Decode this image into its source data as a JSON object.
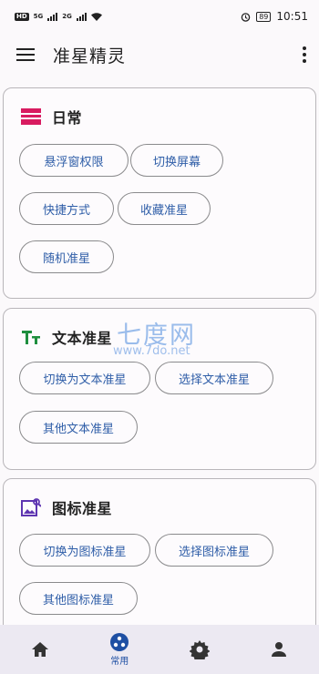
{
  "status_bar": {
    "left_badges": [
      "HD",
      "5G",
      "2G"
    ],
    "battery": "89",
    "time": "10:51"
  },
  "app_bar": {
    "title": "准星精灵"
  },
  "sections": [
    {
      "title": "日常",
      "icon": "calendar-icon",
      "icon_color": "#d81b60",
      "buttons": [
        "悬浮窗权限",
        "切换屏幕",
        "快捷方式",
        "收藏准星",
        "随机准星"
      ]
    },
    {
      "title": "文本准星",
      "icon": "text-format-icon",
      "icon_color": "#1e8e3e",
      "buttons": [
        "切换为文本准星",
        "选择文本准星",
        "其他文本准星"
      ]
    },
    {
      "title": "图标准星",
      "icon": "image-icon",
      "icon_color": "#5e35b1",
      "buttons": [
        "切换为图标准星",
        "选择图标准星",
        "其他图标准星"
      ]
    }
  ],
  "watermark": {
    "text": "七度网",
    "url": "www.7do.net"
  },
  "bottom_nav": {
    "active_label": "常用",
    "items": [
      "home-icon",
      "common-icon",
      "settings-icon",
      "person-icon"
    ],
    "active_color": "#1e4fa3"
  }
}
